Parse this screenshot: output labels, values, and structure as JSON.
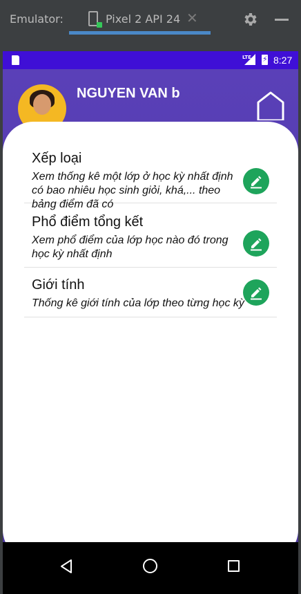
{
  "emulator": {
    "label": "Emulator:",
    "tab_label": "Pixel 2 API 24",
    "close_glyph": "✕"
  },
  "statusbar": {
    "network": "LTE",
    "time": "8:27"
  },
  "header": {
    "username": "NGUYEN VAN b"
  },
  "items": [
    {
      "title": "Xếp loại",
      "description": "Xem thống kê một lớp ở học kỳ nhất định có bao nhiêu học sinh giỏi, khá,... theo bảng điểm đã có"
    },
    {
      "title": "Phổ điểm tổng kết",
      "description": "Xem phổ điểm của lớp học nào đó trong học kỳ nhất định"
    },
    {
      "title": "Giới tính",
      "description": "Thống kê giới tính của lớp theo từng học kỳ"
    }
  ],
  "colors": {
    "statusbar": "#3f0fd6",
    "header": "#5a40b8",
    "edit_button": "#1ea45b",
    "tab_underline": "#4a88c7"
  },
  "icons": {
    "edit": "pencil-icon",
    "home": "home-icon",
    "settings": "gear-icon"
  }
}
